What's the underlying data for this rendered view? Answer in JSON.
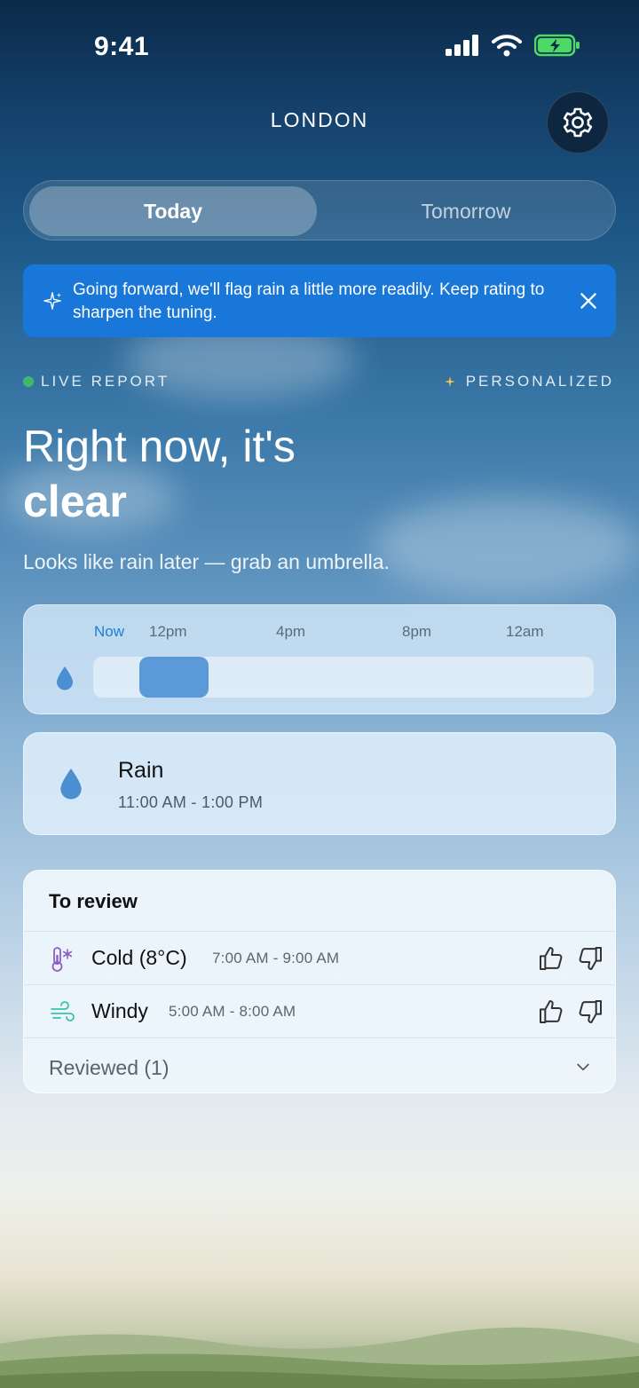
{
  "status_bar": {
    "time": "9:41"
  },
  "header": {
    "city": "LONDON",
    "settings_icon": "gear-icon"
  },
  "tabs": [
    {
      "label": "Today",
      "active": true
    },
    {
      "label": "Tomorrow",
      "active": false
    }
  ],
  "banner": {
    "text": "Going forward, we'll flag rain a little more readily. Keep rating to sharpen the tuning.",
    "color": "#1877d9"
  },
  "report": {
    "live_label": "LIVE REPORT",
    "personalized_label": "PERSONALIZED",
    "headline_prefix": "Right now, it's",
    "headline_condition": "clear",
    "subline": "Looks like rain later — grab an umbrella."
  },
  "timeline": {
    "labels": [
      "Now",
      "12pm",
      "4pm",
      "8pm",
      "12am"
    ],
    "rain_start_fraction": 0.092,
    "rain_end_fraction": 0.23
  },
  "rain_event": {
    "title": "Rain",
    "range": "11:00 AM - 1:00 PM"
  },
  "review": {
    "title": "To review",
    "items": [
      {
        "name": "Cold (8°C)",
        "range": "7:00 AM - 9:00 AM",
        "icon": "thermometer-snow-icon"
      },
      {
        "name": "Windy",
        "range": "5:00 AM - 8:00 AM",
        "icon": "wind-icon"
      }
    ],
    "reviewed_label": "Reviewed (1)"
  }
}
